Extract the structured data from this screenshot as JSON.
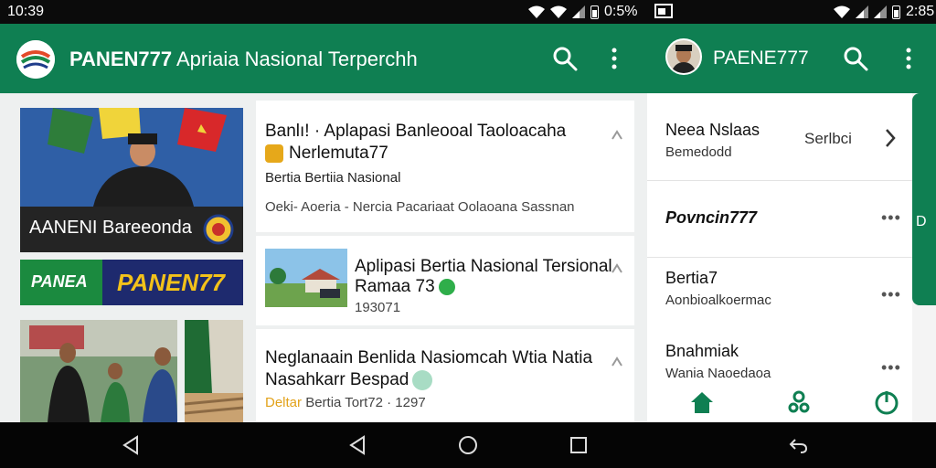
{
  "status_bar": {
    "time_left": "10:39",
    "battery_left": "0:5%",
    "time_right": "2:85"
  },
  "main_app": {
    "title_brand": "PANEN777",
    "title_tagline": "Apriaia Nasional Terperchh",
    "hero_caption": "AANENI Bareeonda",
    "banner_left": "PANEA",
    "banner_right": "PANEN77",
    "articles": [
      {
        "headline_1": "Banlıǃ · Aplapasi Banleooal Taoloacaha",
        "headline_2": "Nerlemuta77",
        "category": "Bertia Bertiia Nasional",
        "meta": "Oeki- Aoeria -  Nercia Pacariaat Oolaoana Sassnan"
      },
      {
        "headline_1": "Aplipasi Bertia Nasional Tersional",
        "headline_2": "Ramaa 73",
        "meta": "193071"
      },
      {
        "headline_1": "Neglanaain Benlida Nasiomcah Wtia Natia",
        "headline_2": "Nasahkarr Bespad",
        "meta_highlight": "Deltar",
        "meta": "Bertia  Tort72 · 1297"
      }
    ]
  },
  "side_app": {
    "title": "PAENE777",
    "rows": [
      {
        "title": "Neea Nslaas",
        "subtitle": "Bemedodd",
        "action": "Serlbci"
      },
      {
        "title": "Povncin777"
      },
      {
        "title": "Bertia7",
        "subtitle": "Aonbioalkoermac"
      },
      {
        "title": "Bnahmiak",
        "subtitle": "Wania Naoedaoa"
      }
    ],
    "edge_tab_letter": "D"
  },
  "colors": {
    "brand_green": "#0f7f52",
    "accent_orange": "#e2a21a",
    "banner_yellow": "#f3c21a"
  },
  "icons": [
    "search-icon",
    "more-vert-icon",
    "share-icon",
    "chevron-right-icon",
    "home-icon",
    "apps-icon",
    "power-icon",
    "back-icon",
    "home-circle-icon",
    "recents-icon"
  ]
}
